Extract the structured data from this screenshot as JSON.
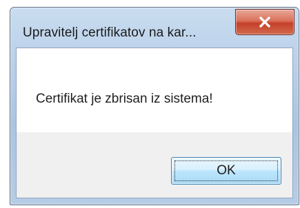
{
  "dialog": {
    "title": "Upravitelj certifikatov na kar...",
    "message": "Certifikat je zbrisan iz sistema!",
    "ok_label": "OK",
    "close_icon": "close-icon"
  },
  "colors": {
    "close_button": "#c4402a",
    "ok_button_border": "#3c7fb1",
    "client_background": "#f0f0f0",
    "content_background": "#ffffff"
  }
}
